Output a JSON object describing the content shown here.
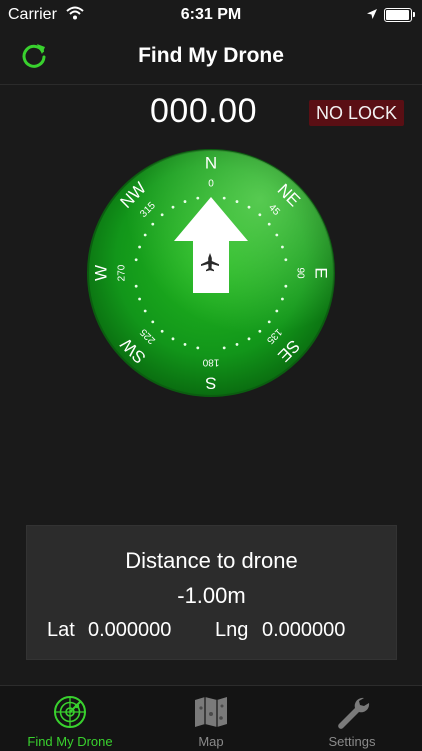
{
  "status_bar": {
    "carrier": "Carrier",
    "time": "6:31 PM",
    "battery_level": 0.95
  },
  "nav": {
    "title": "Find My Drone",
    "refresh_icon": "refresh-icon"
  },
  "readout": {
    "heading_value": "000.00",
    "lock_status": "NO LOCK"
  },
  "compass": {
    "cardinals": [
      "N",
      "NE",
      "E",
      "SE",
      "S",
      "SW",
      "W",
      "NW"
    ],
    "degrees": [
      "0",
      "45",
      "90",
      "135",
      "180",
      "225",
      "270",
      "315"
    ],
    "arrow_icon": "arrow-up-icon",
    "drone_icon": "airplane-icon",
    "colors": {
      "accent": "#39d12e",
      "dial": "#1aa51a",
      "badge": "#5a0f14"
    }
  },
  "info": {
    "distance_label": "Distance to drone",
    "distance_value": "-1.00m",
    "lat_label": "Lat",
    "lat_value": "0.000000",
    "lng_label": "Lng",
    "lng_value": "0.000000"
  },
  "tabs": [
    {
      "label": "Find My Drone",
      "icon": "radar-icon",
      "active": true
    },
    {
      "label": "Map",
      "icon": "map-icon",
      "active": false
    },
    {
      "label": "Settings",
      "icon": "wrench-icon",
      "active": false
    }
  ]
}
